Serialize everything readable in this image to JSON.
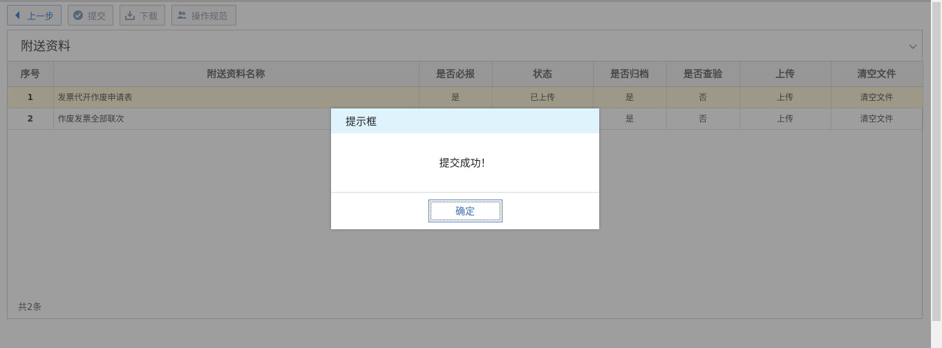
{
  "toolbar": {
    "back_label": "上一步",
    "submit_label": "提交",
    "download_label": "下载",
    "rules_label": "操作规范"
  },
  "panel": {
    "title": "附送资料",
    "columns": [
      "序号",
      "附送资料名称",
      "是否必报",
      "状态",
      "是否归档",
      "是否查验",
      "上传",
      "清空文件"
    ],
    "rows": [
      {
        "idx": "1",
        "name": "发票代开作废申请表",
        "required": "是",
        "status": "已上传",
        "archived": "是",
        "checked": "否",
        "upload": "上传",
        "clear": "清空文件"
      },
      {
        "idx": "2",
        "name": "作废发票全部联次",
        "required": "",
        "status": "",
        "archived": "是",
        "checked": "否",
        "upload": "上传",
        "clear": "清空文件"
      }
    ],
    "total": "共2条"
  },
  "dialog": {
    "title": "提示框",
    "message": "提交成功！",
    "ok_label": "确定"
  },
  "icons": {
    "back": "caret-left-icon",
    "submit": "check-circle-icon",
    "download": "inbox-download-icon",
    "rules": "users-icon",
    "collapse": "chevron-down-icon"
  },
  "colors": {
    "accent": "#4c8ad7",
    "dialog_header": "#dff3fd",
    "highlight_row": "#fff6db"
  }
}
